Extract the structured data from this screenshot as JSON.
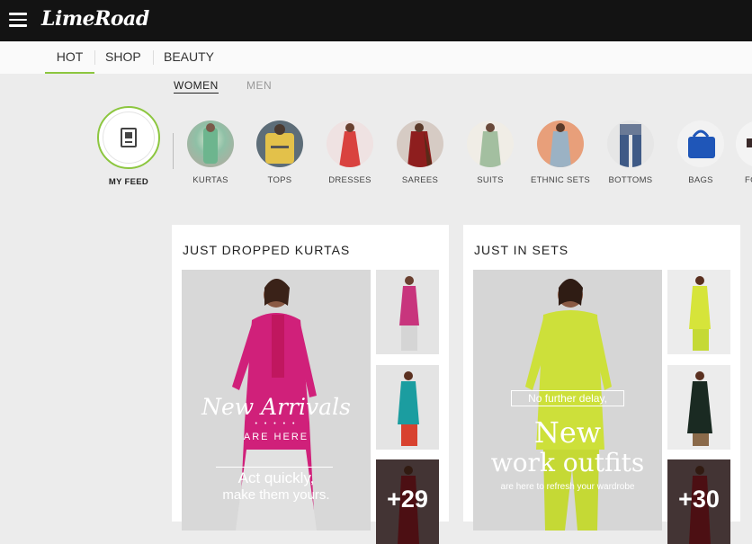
{
  "app": {
    "logo": "LimeRoad"
  },
  "tabs": [
    {
      "label": "HOT",
      "active": true
    },
    {
      "label": "SHOP",
      "active": false
    },
    {
      "label": "BEAUTY",
      "active": false
    }
  ],
  "gender": {
    "women": "WOMEN",
    "men": "MEN"
  },
  "myfeed": {
    "label": "MY FEED"
  },
  "categories": [
    {
      "label": "KURTAS"
    },
    {
      "label": "TOPS"
    },
    {
      "label": "DRESSES"
    },
    {
      "label": "SAREES"
    },
    {
      "label": "SUITS"
    },
    {
      "label": "ETHNIC SETS"
    },
    {
      "label": "BOTTOMS"
    },
    {
      "label": "BAGS"
    },
    {
      "label": "FO"
    }
  ],
  "cards": [
    {
      "title": "JUST DROPPED KURTAS",
      "overlay": {
        "line1": "New Arrivals",
        "dots": "• • • • •",
        "line2": "ARE HERE",
        "line3": "Act quickly,",
        "line4": "make them yours."
      },
      "more_count": "+29"
    },
    {
      "title": "JUST IN SETS",
      "overlay": {
        "line1": "No further delay,",
        "line2": "New",
        "line3": "work outfits",
        "line4": "are here to refresh your wardrobe"
      },
      "more_count": "+30"
    }
  ],
  "colors": {
    "accent": "#8cc63f",
    "topbar": "#131313"
  }
}
